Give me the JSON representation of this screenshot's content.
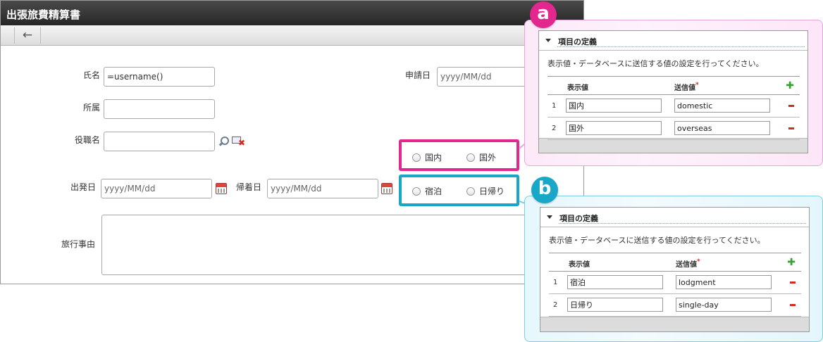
{
  "form": {
    "title": "出張旅費精算書",
    "fields": {
      "name_label": "氏名",
      "name_value": "=username()",
      "apply_date_label": "申請日",
      "apply_date_placeholder": "yyyy/MM/dd",
      "affiliation_label": "所属",
      "position_label": "役職名",
      "departure_label": "出発日",
      "departure_placeholder": "yyyy/MM/dd",
      "return_label": "帰着日",
      "return_placeholder": "yyyy/MM/dd",
      "reason_label": "旅行事由"
    },
    "radio_a": [
      "国内",
      "国外"
    ],
    "radio_b": [
      "宿泊",
      "日帰り"
    ]
  },
  "callout_a": {
    "badge": "a",
    "section_title": "項目の定義",
    "description": "表示値・データベースに送信する値の設定を行ってください。",
    "col_display": "表示値",
    "col_send": "送信値",
    "required_mark": "*",
    "rows": [
      {
        "num": "1",
        "display": "国内",
        "send": "domestic"
      },
      {
        "num": "2",
        "display": "国外",
        "send": "overseas"
      }
    ]
  },
  "callout_b": {
    "badge": "b",
    "section_title": "項目の定義",
    "description": "表示値・データベースに送信する値の設定を行ってください。",
    "col_display": "表示値",
    "col_send": "送信値",
    "required_mark": "*",
    "rows": [
      {
        "num": "1",
        "display": "宿泊",
        "send": "lodgment"
      },
      {
        "num": "2",
        "display": "日帰り",
        "send": "single-day"
      }
    ]
  },
  "colors": {
    "highlight_a": "#e2288f",
    "highlight_b": "#19a7c7",
    "titlebar": "#333333"
  }
}
